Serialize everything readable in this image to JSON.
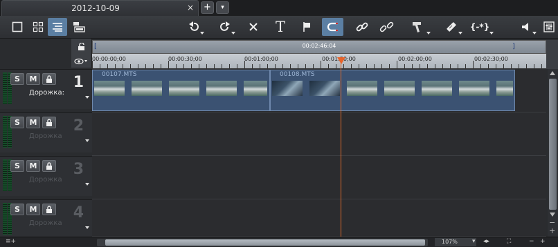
{
  "tab": {
    "title": "2012-10-09",
    "close": "×",
    "add": "+",
    "menu": "▾"
  },
  "toolbar": {
    "text_tool": "T",
    "markers_label": "{-*}"
  },
  "ruler": {
    "duration": "00:02:46:04",
    "timecodes": [
      "00:00:00;00",
      "00:00:30;00",
      "00:01:00;00",
      "00:01:30;00",
      "00:02:00;00",
      "00:02:30;00"
    ]
  },
  "tracks": [
    {
      "number": "1",
      "name": "Дорожка:",
      "active": true,
      "solo": "S",
      "mute": "M"
    },
    {
      "number": "2",
      "name": "Дорожка",
      "active": false,
      "solo": "S",
      "mute": "M"
    },
    {
      "number": "3",
      "name": "Дорожка",
      "active": false,
      "solo": "S",
      "mute": "M"
    },
    {
      "number": "4",
      "name": "Дорожка",
      "active": false,
      "solo": "S",
      "mute": "M"
    }
  ],
  "clips": [
    {
      "name": "00107.MTS"
    },
    {
      "name": "00108.MTS"
    }
  ],
  "status": {
    "zoom": "107%"
  },
  "colors": {
    "accent": "#5b7fa3",
    "playhead": "#e8642a",
    "clip": "#3b5272"
  }
}
